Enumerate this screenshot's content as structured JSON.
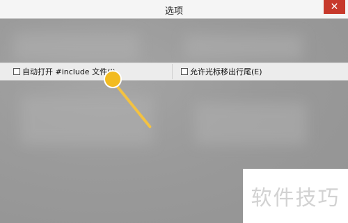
{
  "window": {
    "title": "选项",
    "close_glyph": "✕"
  },
  "options": {
    "left": {
      "label": "自动打开 #include 文件(I)",
      "checked": false
    },
    "right": {
      "label": "允许光标移出行尾(E)",
      "checked": false
    }
  },
  "pointer": {
    "color": "#f2bb21"
  },
  "watermark": {
    "text": "软件技巧"
  }
}
